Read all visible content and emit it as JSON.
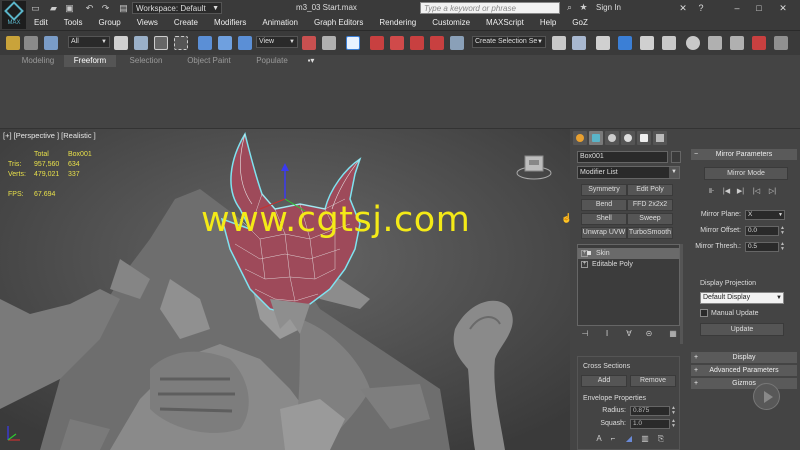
{
  "title_bar": {
    "app_logo": "MAX",
    "workspace": "Workspace: Default",
    "file_title": "m3_03 Start.max",
    "search_placeholder": "Type a keyword or phrase",
    "sign_in": "Sign In",
    "menu": [
      "Edit",
      "Tools",
      "Group",
      "Views",
      "Create",
      "Modifiers",
      "Animation",
      "Graph Editors",
      "Rendering",
      "Customize",
      "MAXScript",
      "Help",
      "GoZ"
    ]
  },
  "toolbar": {
    "selection_filter": "All",
    "ref_coord": "View",
    "named_selection": "Create Selection Se"
  },
  "ribbon": {
    "tabs": [
      "Modeling",
      "Freeform",
      "Selection",
      "Object Paint",
      "Populate"
    ],
    "active_tab": "Freeform"
  },
  "viewport": {
    "label": "[+] [Perspective ] [Realistic ]",
    "stats": {
      "header_total": "Total",
      "header_obj": "Box001",
      "tris_label": "Tris:",
      "tris_total": "957,560",
      "tris_obj": "634",
      "verts_label": "Verts:",
      "verts_total": "479,021",
      "verts_obj": "337",
      "fps_label": "FPS:",
      "fps_value": "67.694"
    },
    "watermark": "www.cgtsj.com"
  },
  "command_panel": {
    "object_name": "Box001",
    "modifier_list": "Modifier List",
    "modifier_buttons": [
      "Symmetry",
      "Edit Poly",
      "Bend",
      "FFD 2x2x2",
      "Shell",
      "Sweep",
      "Unwrap UVW",
      "TurboSmooth"
    ],
    "stack": [
      "Skin",
      "Editable Poly"
    ],
    "selected_stack_item": "Skin",
    "cross_sections": {
      "title": "Cross Sections",
      "add": "Add",
      "remove": "Remove"
    },
    "envelope": {
      "title": "Envelope Properties",
      "radius_label": "Radius:",
      "radius_value": "0.875",
      "squash_label": "Squash:",
      "squash_value": "1.0"
    },
    "mirror": {
      "title": "Mirror Parameters",
      "mode_button": "Mirror Mode",
      "plane_label": "Mirror Plane:",
      "plane_value": "X",
      "offset_label": "Mirror Offset:",
      "offset_value": "0.0",
      "thresh_label": "Mirror Thresh.:",
      "thresh_value": "0.5",
      "projection_label": "Display Projection",
      "projection_value": "Default Display",
      "manual_update": "Manual Update",
      "update_button": "Update"
    },
    "collapsed_rollouts": [
      "Display",
      "Advanced Parameters",
      "Gizmos"
    ]
  },
  "colors": {
    "watermark": "#f4ea17",
    "stats_text": "#e8e04a",
    "selected_mesh": "#9e4a5a",
    "selection_outline": "#7fe3f0"
  }
}
